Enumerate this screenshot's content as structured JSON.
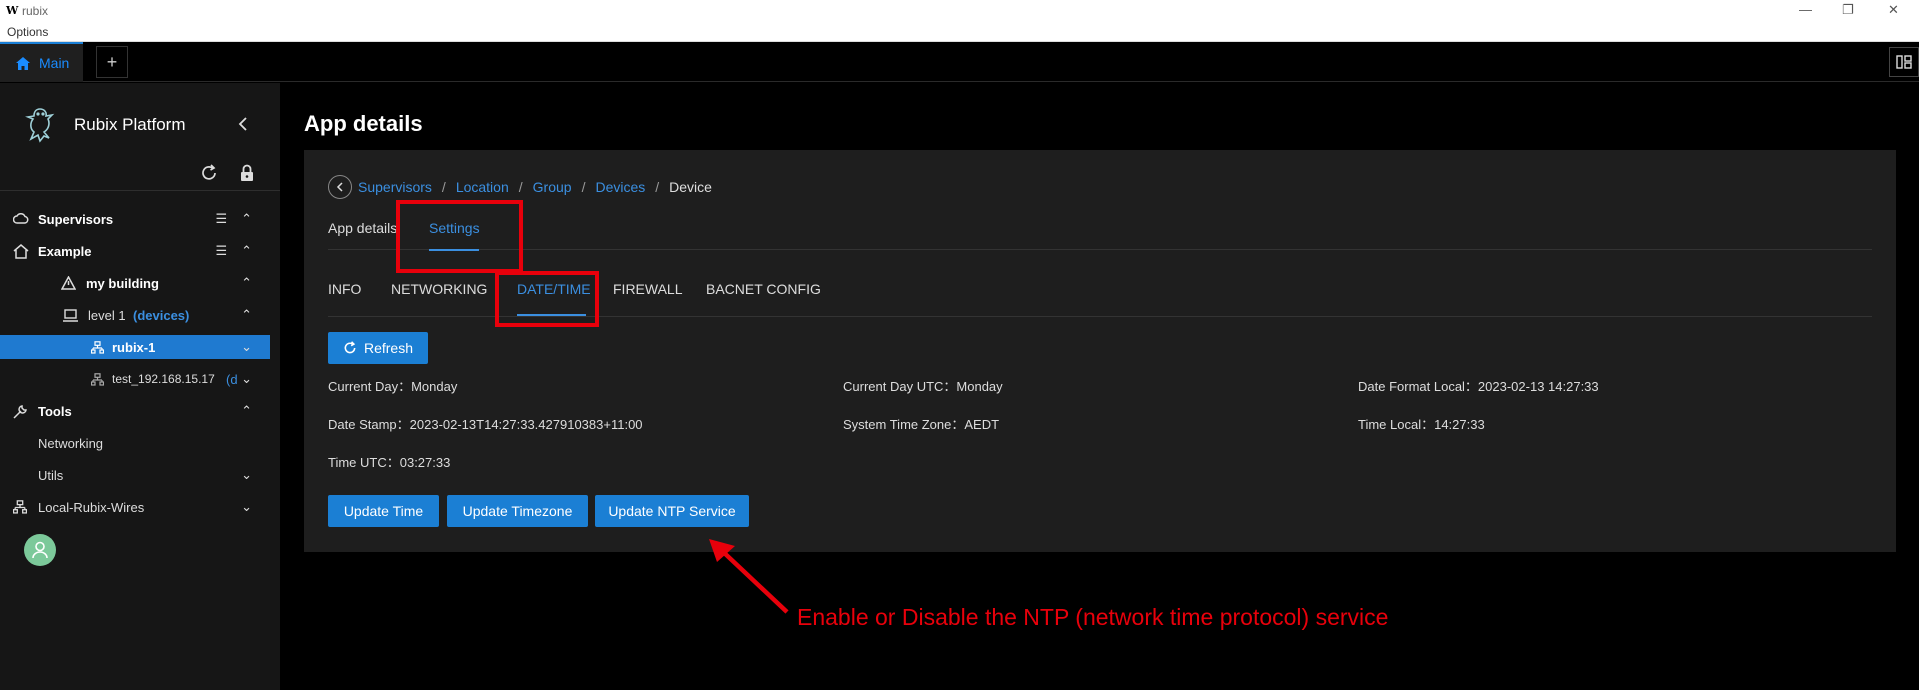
{
  "window": {
    "logo": "W",
    "title": "rubix",
    "menu": "Options"
  },
  "tabs": {
    "main": "Main",
    "add": "+"
  },
  "sidebar": {
    "brand": "Rubix Platform",
    "items": [
      {
        "label": "Supervisors"
      },
      {
        "label": "Example"
      },
      {
        "label": "my building"
      },
      {
        "label": "level 1",
        "suffix": "(devices)"
      },
      {
        "label": "rubix-1"
      },
      {
        "label": "test_192.168.15.17",
        "suffix": "(d"
      },
      {
        "label": "Tools"
      },
      {
        "label": "Networking"
      },
      {
        "label": "Utils"
      },
      {
        "label": "Local-Rubix-Wires"
      }
    ]
  },
  "main": {
    "title": "App details",
    "breadcrumb": [
      "Supervisors",
      "Location",
      "Group",
      "Devices",
      "Device"
    ],
    "crumb_sep": "/",
    "top_tabs": [
      "App details",
      "Settings"
    ],
    "sub_tabs": [
      "INFO",
      "NETWORKING",
      "DATE/TIME",
      "FIREWALL",
      "BACNET CONFIG"
    ],
    "refresh": "Refresh",
    "fields": {
      "current_day": "Current Day：Monday",
      "current_day_utc": "Current Day UTC：Monday",
      "date_format_local": "Date Format Local：2023-02-13 14:27:33",
      "date_stamp": "Date Stamp：2023-02-13T14:27:33.427910383+11:00",
      "system_tz": "System Time Zone：AEDT",
      "time_local": "Time Local：14:27:33",
      "time_utc": "Time UTC：03:27:33"
    },
    "buttons": {
      "update_time": "Update Time",
      "update_tz": "Update Timezone",
      "update_ntp": "Update NTP Service"
    }
  },
  "annotation": {
    "text": "Enable or Disable the NTP (network time protocol) service",
    "color": "#e8000b"
  },
  "colors": {
    "accent": "#1b7fd4",
    "link": "#3b8fe0",
    "sidebar_bg": "#161616",
    "panel_bg": "#1e1e1e"
  }
}
